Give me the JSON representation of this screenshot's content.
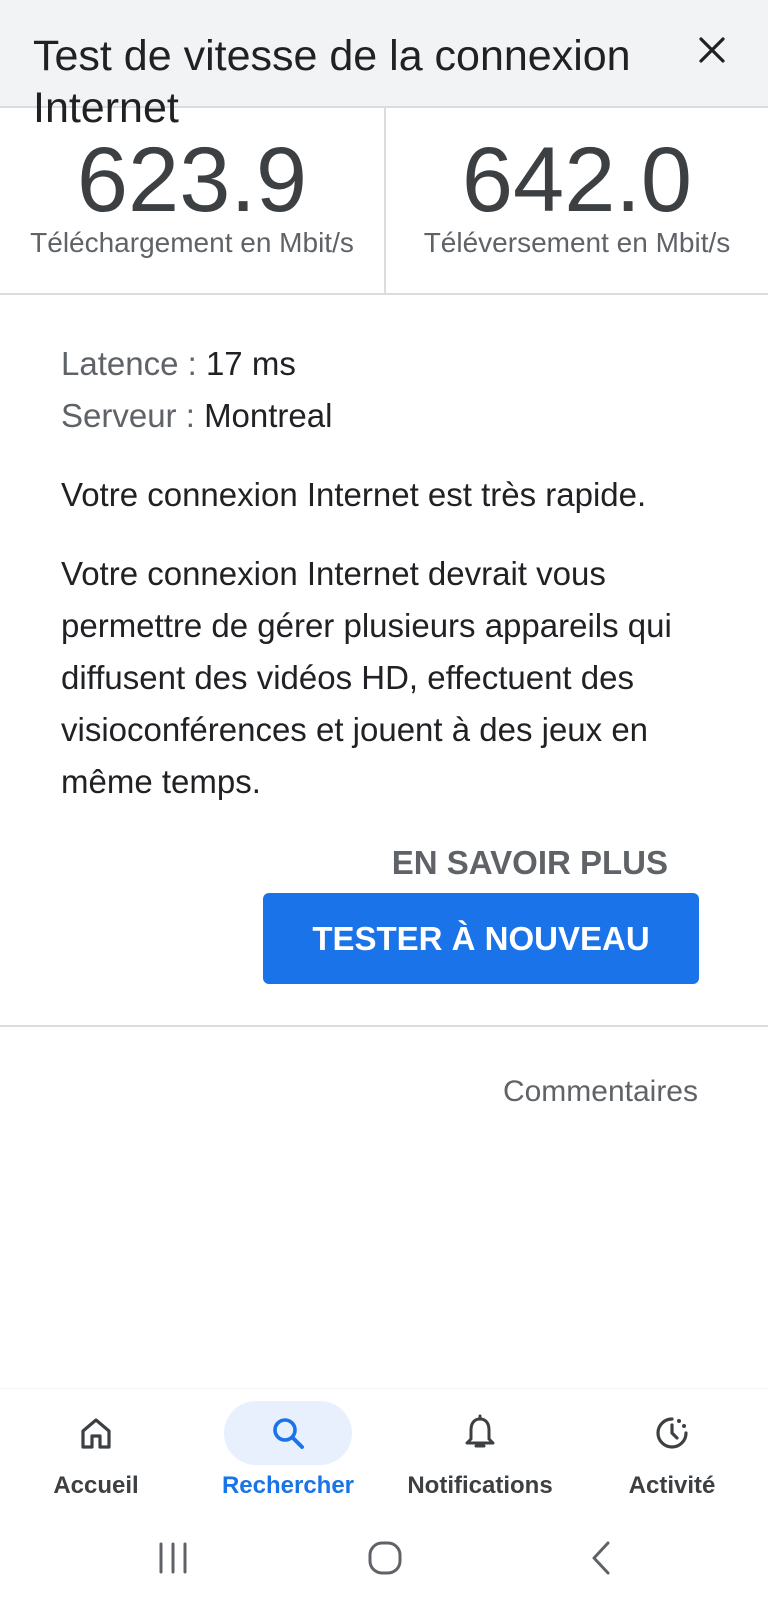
{
  "header": {
    "title": "Test de vitesse de la connexion Internet"
  },
  "results": {
    "download": {
      "value": "623.9",
      "label": "Téléchargement en Mbit/s"
    },
    "upload": {
      "value": "642.0",
      "label": "Téléversement en Mbit/s"
    }
  },
  "details": {
    "latency_label": "Latence : ",
    "latency_value": "17 ms",
    "server_label": "Serveur : ",
    "server_value": "Montreal"
  },
  "summary": "Votre connexion Internet est très rapide.",
  "description": "Votre connexion Internet devrait vous permettre de gérer plusieurs appareils qui diffusent des vidéos HD, effectuent des visioconférences et jouent à des jeux en même temps.",
  "actions": {
    "learn_more": "EN SAVOIR PLUS",
    "retest": "TESTER À NOUVEAU"
  },
  "feedback": "Commentaires",
  "bottom_nav": {
    "items": [
      {
        "label": "Accueil",
        "icon": "home-icon",
        "active": false
      },
      {
        "label": "Rechercher",
        "icon": "search-icon",
        "active": true
      },
      {
        "label": "Notifications",
        "icon": "bell-icon",
        "active": false
      },
      {
        "label": "Activité",
        "icon": "activity-icon",
        "active": false
      }
    ]
  },
  "colors": {
    "accent": "#1a73e8",
    "active_pill": "#e8f0fe",
    "header_bg": "#f1f3f4",
    "divider": "#dadce0"
  }
}
